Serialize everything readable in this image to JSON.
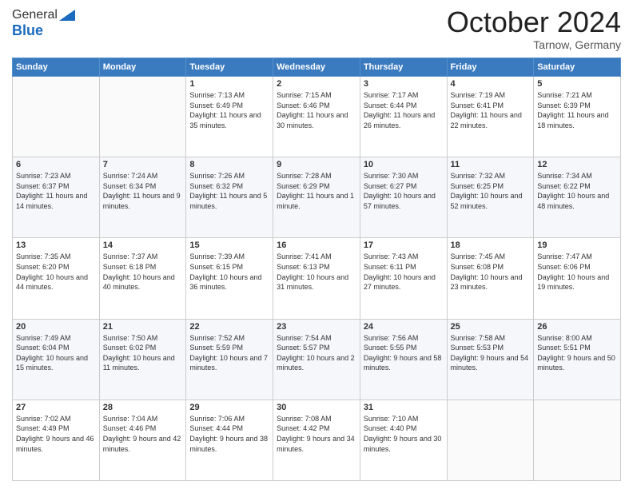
{
  "header": {
    "logo": {
      "general": "General",
      "blue": "Blue"
    },
    "title": "October 2024",
    "location": "Tarnow, Germany"
  },
  "days_of_week": [
    "Sunday",
    "Monday",
    "Tuesday",
    "Wednesday",
    "Thursday",
    "Friday",
    "Saturday"
  ],
  "weeks": [
    [
      {
        "day": "",
        "info": ""
      },
      {
        "day": "",
        "info": ""
      },
      {
        "day": "1",
        "info": "Sunrise: 7:13 AM\nSunset: 6:49 PM\nDaylight: 11 hours and 35 minutes."
      },
      {
        "day": "2",
        "info": "Sunrise: 7:15 AM\nSunset: 6:46 PM\nDaylight: 11 hours and 30 minutes."
      },
      {
        "day": "3",
        "info": "Sunrise: 7:17 AM\nSunset: 6:44 PM\nDaylight: 11 hours and 26 minutes."
      },
      {
        "day": "4",
        "info": "Sunrise: 7:19 AM\nSunset: 6:41 PM\nDaylight: 11 hours and 22 minutes."
      },
      {
        "day": "5",
        "info": "Sunrise: 7:21 AM\nSunset: 6:39 PM\nDaylight: 11 hours and 18 minutes."
      }
    ],
    [
      {
        "day": "6",
        "info": "Sunrise: 7:23 AM\nSunset: 6:37 PM\nDaylight: 11 hours and 14 minutes."
      },
      {
        "day": "7",
        "info": "Sunrise: 7:24 AM\nSunset: 6:34 PM\nDaylight: 11 hours and 9 minutes."
      },
      {
        "day": "8",
        "info": "Sunrise: 7:26 AM\nSunset: 6:32 PM\nDaylight: 11 hours and 5 minutes."
      },
      {
        "day": "9",
        "info": "Sunrise: 7:28 AM\nSunset: 6:29 PM\nDaylight: 11 hours and 1 minute."
      },
      {
        "day": "10",
        "info": "Sunrise: 7:30 AM\nSunset: 6:27 PM\nDaylight: 10 hours and 57 minutes."
      },
      {
        "day": "11",
        "info": "Sunrise: 7:32 AM\nSunset: 6:25 PM\nDaylight: 10 hours and 52 minutes."
      },
      {
        "day": "12",
        "info": "Sunrise: 7:34 AM\nSunset: 6:22 PM\nDaylight: 10 hours and 48 minutes."
      }
    ],
    [
      {
        "day": "13",
        "info": "Sunrise: 7:35 AM\nSunset: 6:20 PM\nDaylight: 10 hours and 44 minutes."
      },
      {
        "day": "14",
        "info": "Sunrise: 7:37 AM\nSunset: 6:18 PM\nDaylight: 10 hours and 40 minutes."
      },
      {
        "day": "15",
        "info": "Sunrise: 7:39 AM\nSunset: 6:15 PM\nDaylight: 10 hours and 36 minutes."
      },
      {
        "day": "16",
        "info": "Sunrise: 7:41 AM\nSunset: 6:13 PM\nDaylight: 10 hours and 31 minutes."
      },
      {
        "day": "17",
        "info": "Sunrise: 7:43 AM\nSunset: 6:11 PM\nDaylight: 10 hours and 27 minutes."
      },
      {
        "day": "18",
        "info": "Sunrise: 7:45 AM\nSunset: 6:08 PM\nDaylight: 10 hours and 23 minutes."
      },
      {
        "day": "19",
        "info": "Sunrise: 7:47 AM\nSunset: 6:06 PM\nDaylight: 10 hours and 19 minutes."
      }
    ],
    [
      {
        "day": "20",
        "info": "Sunrise: 7:49 AM\nSunset: 6:04 PM\nDaylight: 10 hours and 15 minutes."
      },
      {
        "day": "21",
        "info": "Sunrise: 7:50 AM\nSunset: 6:02 PM\nDaylight: 10 hours and 11 minutes."
      },
      {
        "day": "22",
        "info": "Sunrise: 7:52 AM\nSunset: 5:59 PM\nDaylight: 10 hours and 7 minutes."
      },
      {
        "day": "23",
        "info": "Sunrise: 7:54 AM\nSunset: 5:57 PM\nDaylight: 10 hours and 2 minutes."
      },
      {
        "day": "24",
        "info": "Sunrise: 7:56 AM\nSunset: 5:55 PM\nDaylight: 9 hours and 58 minutes."
      },
      {
        "day": "25",
        "info": "Sunrise: 7:58 AM\nSunset: 5:53 PM\nDaylight: 9 hours and 54 minutes."
      },
      {
        "day": "26",
        "info": "Sunrise: 8:00 AM\nSunset: 5:51 PM\nDaylight: 9 hours and 50 minutes."
      }
    ],
    [
      {
        "day": "27",
        "info": "Sunrise: 7:02 AM\nSunset: 4:49 PM\nDaylight: 9 hours and 46 minutes."
      },
      {
        "day": "28",
        "info": "Sunrise: 7:04 AM\nSunset: 4:46 PM\nDaylight: 9 hours and 42 minutes."
      },
      {
        "day": "29",
        "info": "Sunrise: 7:06 AM\nSunset: 4:44 PM\nDaylight: 9 hours and 38 minutes."
      },
      {
        "day": "30",
        "info": "Sunrise: 7:08 AM\nSunset: 4:42 PM\nDaylight: 9 hours and 34 minutes."
      },
      {
        "day": "31",
        "info": "Sunrise: 7:10 AM\nSunset: 4:40 PM\nDaylight: 9 hours and 30 minutes."
      },
      {
        "day": "",
        "info": ""
      },
      {
        "day": "",
        "info": ""
      }
    ]
  ]
}
